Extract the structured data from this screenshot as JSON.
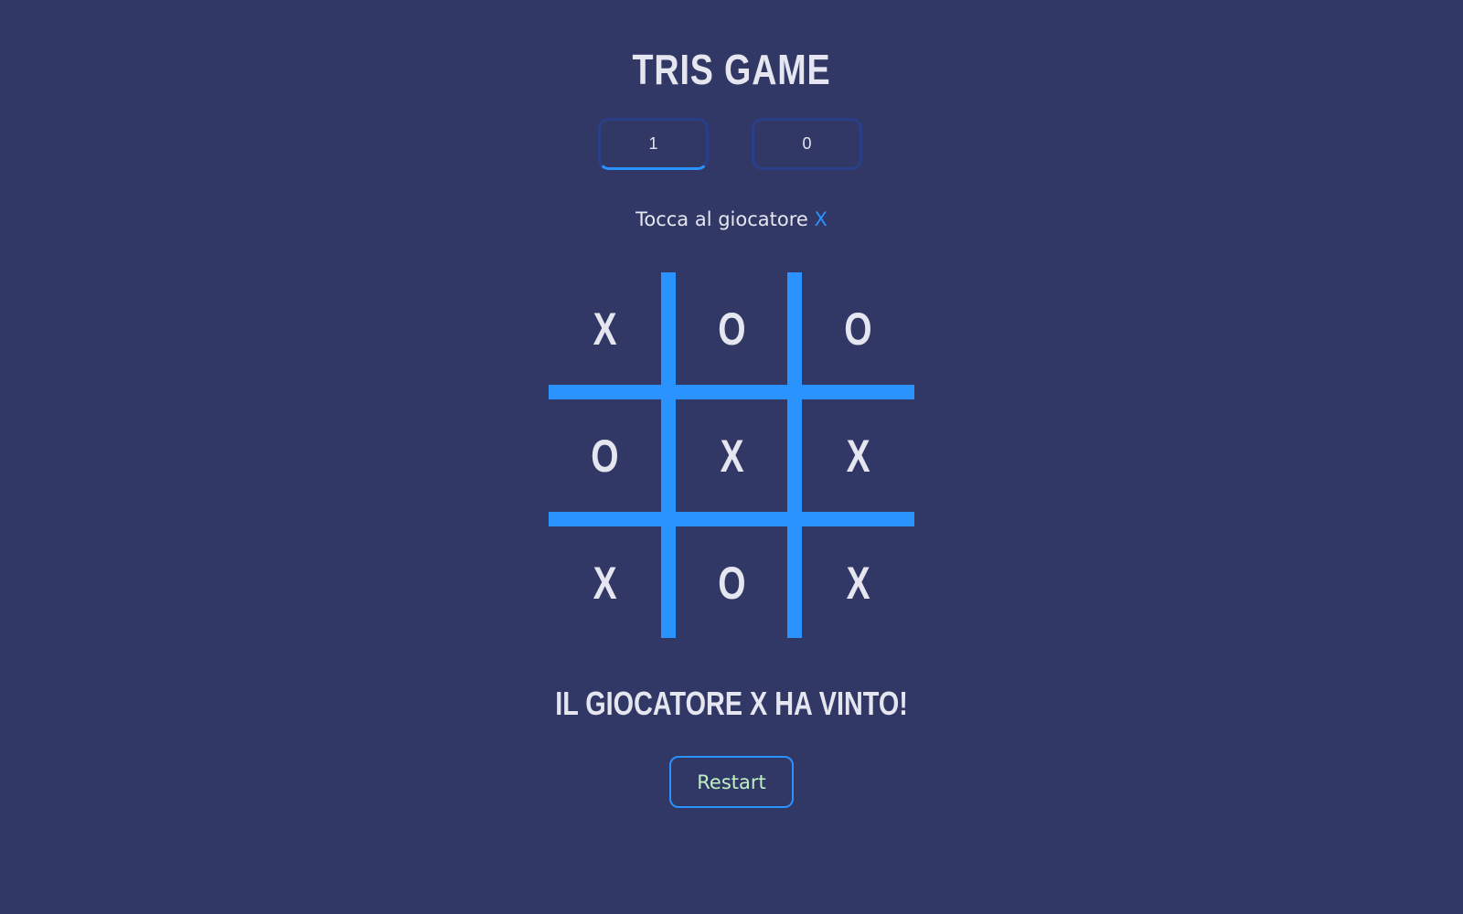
{
  "title": "TRIS GAME",
  "scores": {
    "x": "1",
    "o": "0"
  },
  "turn": {
    "prefix": "Tocca al giocatore",
    "player": "X"
  },
  "board": {
    "cells": [
      "X",
      "O",
      "O",
      "O",
      "X",
      "X",
      "X",
      "O",
      "X"
    ]
  },
  "result": "IL GIOCATORE X HA VINTO!",
  "restart_label": "Restart",
  "colors": {
    "background": "#313866",
    "accent": "#2a93ff",
    "text": "#e6e6f0",
    "restart_text": "#bff0c4"
  }
}
